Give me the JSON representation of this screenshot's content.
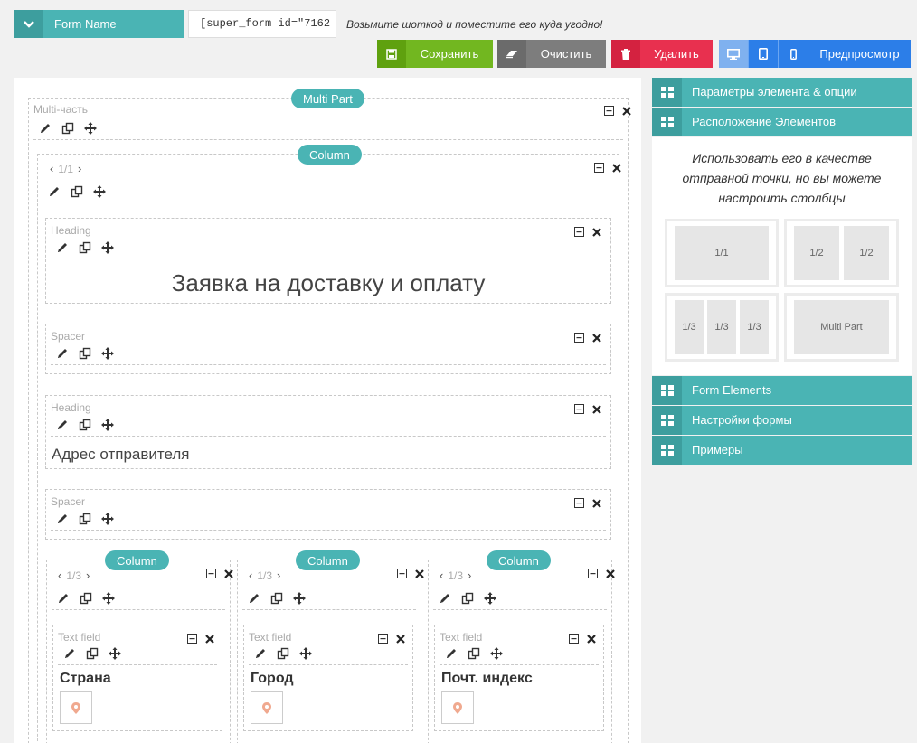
{
  "header": {
    "form_name": "Form Name",
    "shortcode": "[super_form id=\"7162",
    "shortcode_hint": "Возьмите шоткод и поместите его куда угодно!"
  },
  "actions": {
    "save": "Сохранить",
    "clear": "Очистить",
    "delete": "Удалить",
    "preview": "Предпросмотр"
  },
  "canvas": {
    "multipart": {
      "pill": "Multi Part",
      "label": "Multi-часть"
    },
    "column_main": {
      "pill": "Column",
      "pager": "1/1"
    },
    "heading1": {
      "label": "Heading",
      "text": "Заявка на доставку и оплату"
    },
    "spacer1": {
      "label": "Spacer"
    },
    "heading2": {
      "label": "Heading",
      "text": "Адрес отправителя"
    },
    "spacer2": {
      "label": "Spacer"
    },
    "columns": [
      {
        "pill": "Column",
        "pager": "1/3",
        "field_label": "Text field",
        "field_title": "Страна"
      },
      {
        "pill": "Column",
        "pager": "1/3",
        "field_label": "Text field",
        "field_title": "Город"
      },
      {
        "pill": "Column",
        "pager": "1/3",
        "field_label": "Text field",
        "field_title": "Почт. индекс"
      }
    ]
  },
  "sidebar": {
    "items_top": [
      "Параметры элемента & опции",
      "Расположение Элементов"
    ],
    "hint": "Использовать его в качестве отправной точки, но вы можете настроить столбцы",
    "layouts": {
      "one": [
        "1/1"
      ],
      "halves": [
        "1/2",
        "1/2"
      ],
      "thirds": [
        "1/3",
        "1/3",
        "1/3"
      ],
      "multipart": [
        "Multi Part"
      ]
    },
    "items_bottom": [
      "Form Elements",
      "Настройки формы",
      "Примеры"
    ]
  },
  "colors": {
    "teal": "#4ab4b4",
    "save_green": "#72b720",
    "clear_gray": "#7d7d7d",
    "delete_red": "#e8304f",
    "preview_blue": "#2c7ee8"
  }
}
